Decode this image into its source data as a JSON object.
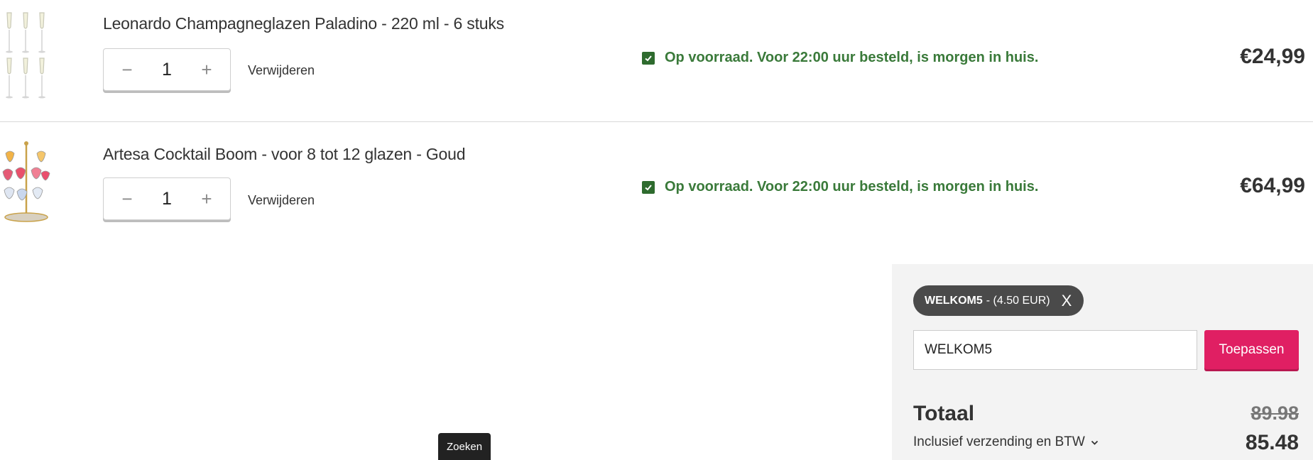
{
  "cart": {
    "items": [
      {
        "title": "Leonardo Champagneglazen Paladino - 220 ml - 6 stuks",
        "quantity": "1",
        "decrement": "−",
        "increment": "+",
        "remove_label": "Verwijderen",
        "stock": "Op voorraad. Voor 22:00 uur besteld, is morgen in huis.",
        "price": "€24,99"
      },
      {
        "title": "Artesa Cocktail Boom - voor 8 tot 12 glazen - Goud",
        "quantity": "1",
        "decrement": "−",
        "increment": "+",
        "remove_label": "Verwijderen",
        "stock": "Op voorraad. Voor 22:00 uur besteld, is morgen in huis.",
        "price": "€64,99"
      }
    ]
  },
  "summary": {
    "coupon_code": "WELKOM5",
    "coupon_amount": "- (4.50 EUR)",
    "coupon_remove": "X",
    "coupon_input_value": "WELKOM5",
    "apply_label": "Toepassen",
    "total_label": "Totaal",
    "old_total": "89.98",
    "incl_label": "Inclusief verzending en BTW",
    "new_total": "85.48"
  },
  "search_tooltip": "Zoeken",
  "colors": {
    "accent": "#e01f63",
    "stock_green": "#3a7a3a",
    "chip_bg": "#4a4a4a",
    "summary_bg": "#f3f3f3"
  },
  "icons": {
    "stock": "check-square-icon",
    "chevron": "chevron-down-icon"
  }
}
